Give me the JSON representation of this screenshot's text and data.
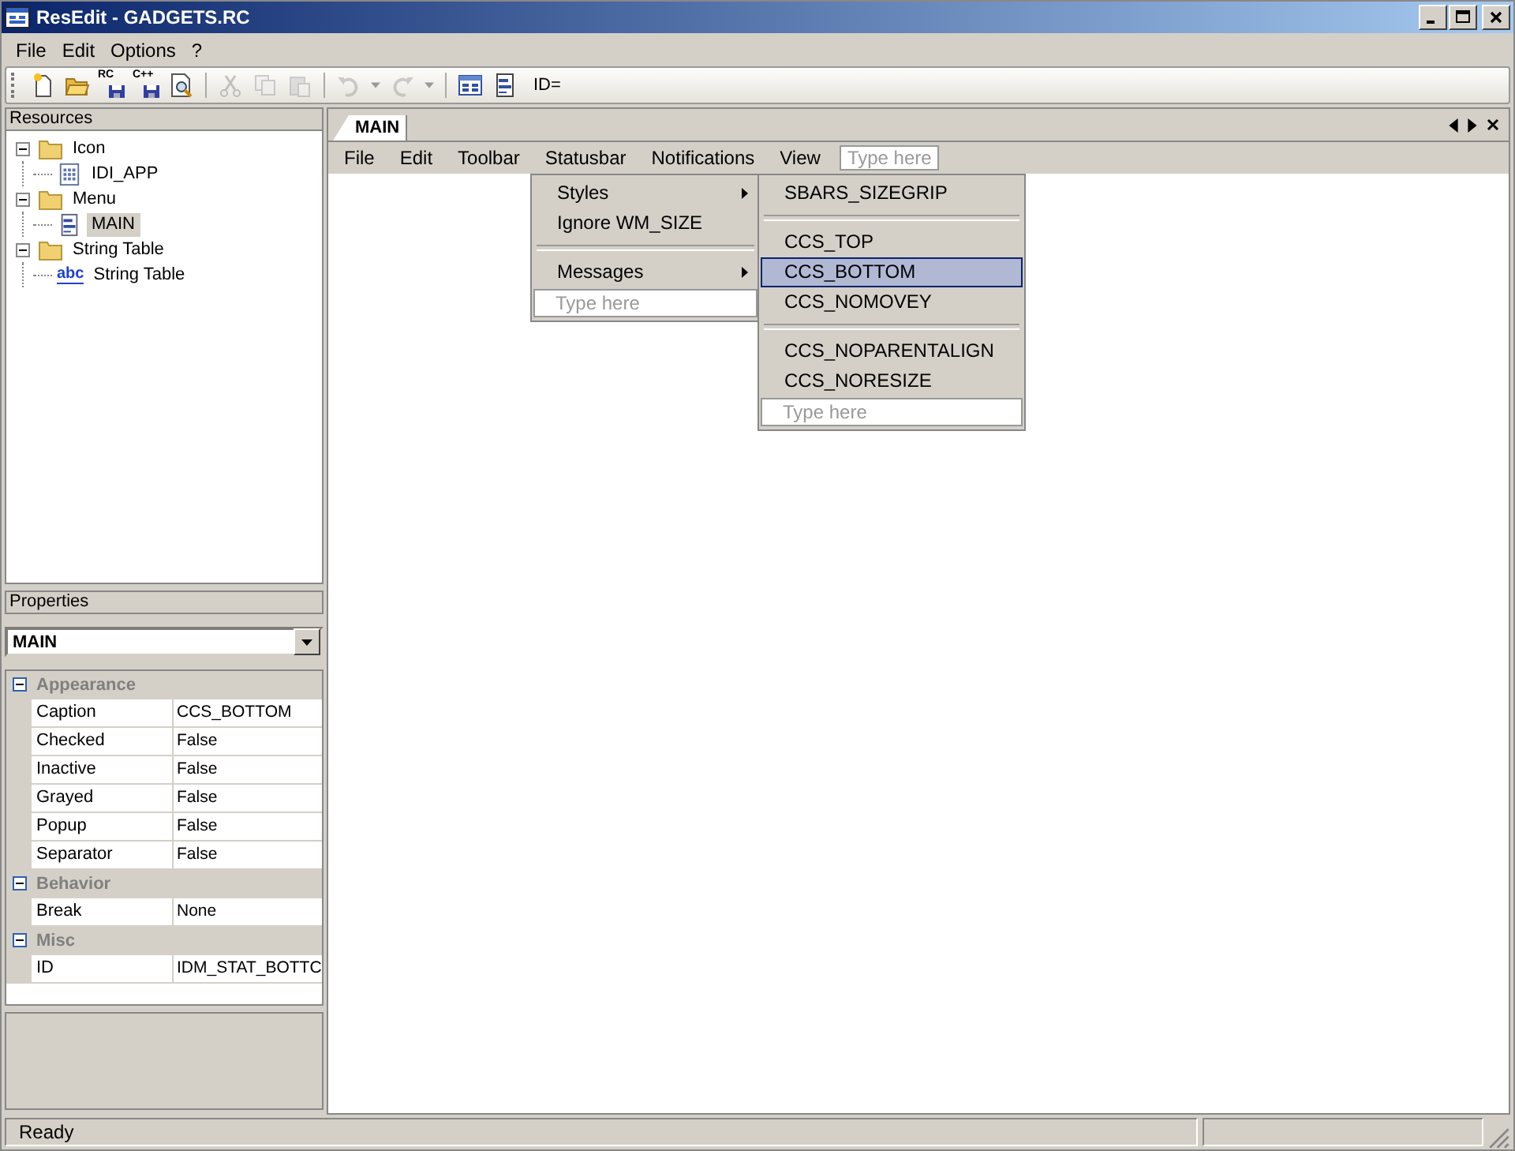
{
  "window": {
    "title": "ResEdit - GADGETS.RC"
  },
  "menubar": [
    "File",
    "Edit",
    "Options",
    "?"
  ],
  "toolbar": [
    {
      "kind": "new",
      "disabled": false
    },
    {
      "kind": "open",
      "disabled": false
    },
    {
      "kind": "save",
      "label": "RC",
      "disabled": false
    },
    {
      "kind": "save",
      "label": "C++",
      "disabled": false
    },
    {
      "kind": "preview",
      "disabled": false
    },
    {
      "kind": "sep"
    },
    {
      "kind": "cut",
      "disabled": true
    },
    {
      "kind": "copy",
      "disabled": true
    },
    {
      "kind": "paste",
      "disabled": true
    },
    {
      "kind": "sep"
    },
    {
      "kind": "undo",
      "disabled": true
    },
    {
      "kind": "redo",
      "disabled": true
    },
    {
      "kind": "sep"
    },
    {
      "kind": "dialog",
      "disabled": false
    },
    {
      "kind": "menu",
      "disabled": false
    }
  ],
  "id_label": "ID=",
  "resources": {
    "title": "Resources",
    "tree": [
      {
        "label": "Icon",
        "kind": "folder",
        "expanded": true,
        "selected": false,
        "children": [
          {
            "label": "IDI_APP",
            "kind": "icon",
            "selected": false
          }
        ]
      },
      {
        "label": "Menu",
        "kind": "folder",
        "expanded": true,
        "selected": false,
        "children": [
          {
            "label": "MAIN",
            "kind": "menu",
            "selected": true
          }
        ]
      },
      {
        "label": "String Table",
        "kind": "folder",
        "expanded": true,
        "selected": false,
        "children": [
          {
            "label": "String Table",
            "kind": "string",
            "badge": "abc",
            "selected": false
          }
        ]
      }
    ]
  },
  "properties": {
    "title": "Properties",
    "object": "MAIN",
    "groups": [
      {
        "name": "Appearance",
        "rows": [
          {
            "name": "Caption",
            "value": "CCS_BOTTOM"
          },
          {
            "name": "Checked",
            "value": "False"
          },
          {
            "name": "Inactive",
            "value": "False"
          },
          {
            "name": "Grayed",
            "value": "False"
          },
          {
            "name": "Popup",
            "value": "False"
          },
          {
            "name": "Separator",
            "value": "False"
          }
        ]
      },
      {
        "name": "Behavior",
        "rows": [
          {
            "name": "Break",
            "value": "None"
          }
        ]
      },
      {
        "name": "Misc",
        "rows": [
          {
            "name": "ID",
            "value": "IDM_STAT_BOTTC"
          }
        ]
      }
    ]
  },
  "document_tab": {
    "label": "MAIN",
    "selected": true
  },
  "menu_designer": {
    "items": [
      "File",
      "Edit",
      "Toolbar",
      "Statusbar",
      "Notifications",
      "View"
    ],
    "placeholder": "Type here",
    "popup": [
      {
        "kind": "item",
        "label": "Styles",
        "submenu": true,
        "selected": false
      },
      {
        "kind": "item",
        "label": "Ignore WM_SIZE",
        "submenu": false,
        "selected": false
      },
      {
        "kind": "separator"
      },
      {
        "kind": "item",
        "label": "Messages",
        "submenu": true,
        "selected": false
      },
      {
        "kind": "placeholder",
        "label": "Type here"
      }
    ],
    "submenu": [
      {
        "kind": "item",
        "label": "SBARS_SIZEGRIP",
        "submenu": false,
        "selected": false
      },
      {
        "kind": "separator"
      },
      {
        "kind": "item",
        "label": "CCS_TOP",
        "submenu": false,
        "selected": false
      },
      {
        "kind": "item",
        "label": "CCS_BOTTOM",
        "submenu": false,
        "selected": true
      },
      {
        "kind": "item",
        "label": "CCS_NOMOVEY",
        "submenu": false,
        "selected": false
      },
      {
        "kind": "separator"
      },
      {
        "kind": "item",
        "label": "CCS_NOPARENTALIGN",
        "submenu": false,
        "selected": false
      },
      {
        "kind": "item",
        "label": "CCS_NORESIZE",
        "submenu": false,
        "selected": false
      },
      {
        "kind": "placeholder",
        "label": "Type here"
      }
    ]
  },
  "status_bar": [
    "Ready"
  ]
}
